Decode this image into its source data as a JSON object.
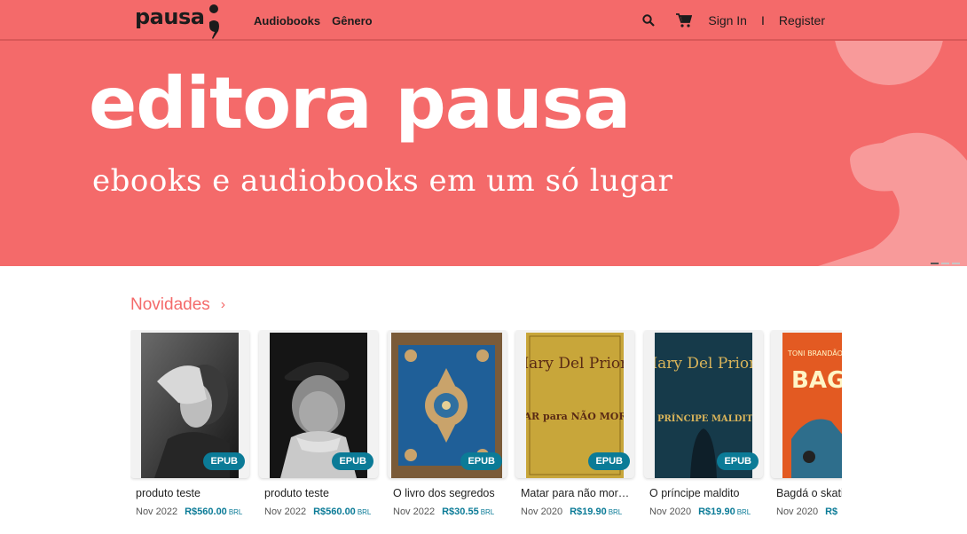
{
  "header": {
    "logo_text": "pausa",
    "nav": [
      "Audiobooks",
      "Gênero"
    ],
    "sign_in": "Sign In",
    "separator": "I",
    "register": "Register"
  },
  "banner": {
    "title": "editora pausa",
    "subtitle": "ebooks e audiobooks em um só lugar"
  },
  "section": {
    "title": "Novidades",
    "chevron": "›"
  },
  "products": [
    {
      "title": "produto teste",
      "date": "Nov 2022",
      "price": "R$560.00",
      "currency": "BRL",
      "format": "EPUB"
    },
    {
      "title": "produto teste",
      "date": "Nov 2022",
      "price": "R$560.00",
      "currency": "BRL",
      "format": "EPUB"
    },
    {
      "title": "O livro dos segredos",
      "date": "Nov 2022",
      "price": "R$30.55",
      "currency": "BRL",
      "format": "EPUB"
    },
    {
      "title": "Matar para não morrer",
      "date": "Nov 2020",
      "price": "R$19.90",
      "currency": "BRL",
      "format": "EPUB"
    },
    {
      "title": "O príncipe maldito",
      "date": "Nov 2020",
      "price": "R$19.90",
      "currency": "BRL",
      "format": "EPUB"
    },
    {
      "title": "Bagdá o skatista",
      "date": "Nov 2020",
      "price": "R$",
      "currency": "",
      "format": ""
    }
  ],
  "covers": [
    {
      "author": "",
      "title": ""
    },
    {
      "author": "",
      "title": ""
    },
    {
      "author": "",
      "title": ""
    },
    {
      "author": "Mary Del Priore",
      "title": "MATAR para NÃO MORRER"
    },
    {
      "author": "Mary Del Priore",
      "title": "O PRÍNCIPE MALDITO"
    },
    {
      "author": "TONI BRANDÃO",
      "title": "BAG"
    }
  ],
  "colors": {
    "brand": "#f46a6a",
    "accent": "#0b7b97"
  }
}
